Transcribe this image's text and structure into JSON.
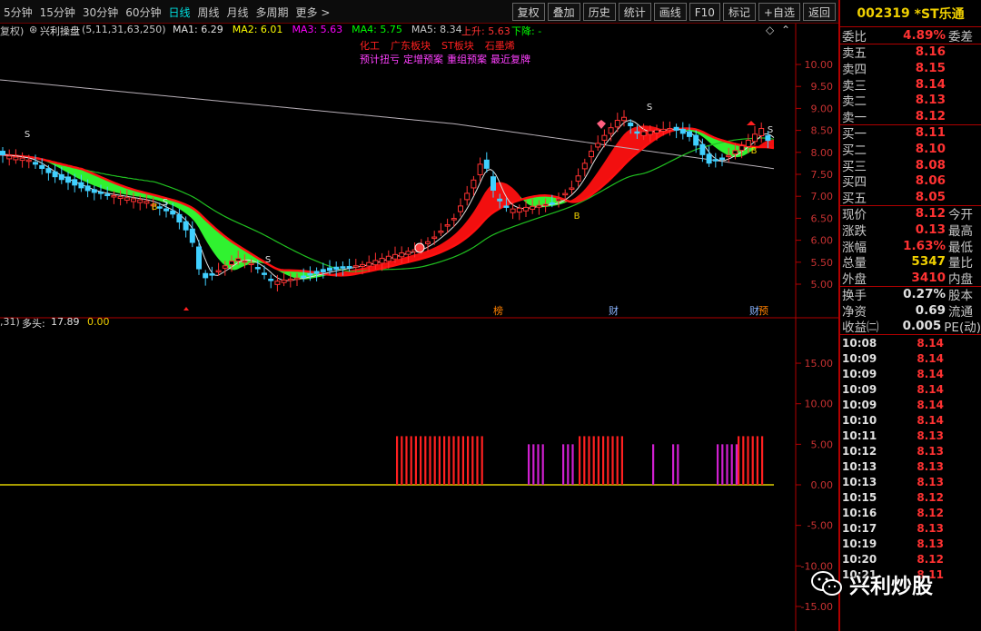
{
  "toolbar": {
    "periods": [
      "5分钟",
      "15分钟",
      "30分钟",
      "60分钟",
      "日线",
      "周线",
      "月线",
      "多周期",
      "更多 >"
    ],
    "active_period": "日线",
    "buttons": [
      "复权",
      "叠加",
      "历史",
      "统计",
      "画线",
      "F10",
      "标记",
      "+自选",
      "返回"
    ]
  },
  "main_chart": {
    "fuquan_label": "复权)",
    "indicator_name": "兴利操盘",
    "indicator_params": "(5,11,31,63,250)",
    "ma": [
      {
        "label": "MA1:",
        "value": "6.29",
        "color": "#e0e0e0"
      },
      {
        "label": "MA2:",
        "value": "6.01",
        "color": "#ffff00"
      },
      {
        "label": "MA3:",
        "value": "5.63",
        "color": "#ff00ff"
      },
      {
        "label": "MA4:",
        "value": "5.75",
        "color": "#00ff00"
      },
      {
        "label": "MA5:",
        "value": "8.34",
        "color": "#c8c8c8"
      }
    ],
    "up_label": "上升: 5.63",
    "down_label": "下降: -",
    "tags_line1": [
      "化工",
      "广东板块",
      "ST板块",
      "石墨烯"
    ],
    "tags_line2": [
      "预计扭亏",
      "定增预案",
      "重组预案",
      "最近复牌"
    ],
    "y_ticks": [
      "10.00",
      "9.50",
      "9.00",
      "8.50",
      "8.00",
      "7.50",
      "7.00",
      "6.50",
      "6.00",
      "5.50",
      "5.00"
    ],
    "events": [
      "榜",
      "财",
      "预"
    ]
  },
  "sub_chart": {
    "param": ",31)",
    "name": "多头:",
    "v1": "17.89",
    "v2": "0.00",
    "y_ticks": [
      "15.00",
      "10.00",
      "5.00",
      "0.00",
      "-5.00",
      "-10.00",
      "-15.00"
    ]
  },
  "chart_data": {
    "type": "bar",
    "title": "多头",
    "ylim": [
      -17,
      19
    ],
    "series": [
      {
        "name": "多头",
        "values_note": "bars at 6.0 during bullish periods"
      }
    ],
    "bars": [
      {
        "color": "#ff2020",
        "value": 6.0,
        "count": 19
      },
      {
        "color": "#d020d0",
        "value": 5.0,
        "count": 4
      },
      {
        "color": "#d020d0",
        "value": 5.0,
        "count": 3
      },
      {
        "color": "#ff2020",
        "value": 6.0,
        "count": 10
      },
      {
        "color": "#d020d0",
        "value": 5.0,
        "count": 1
      },
      {
        "color": "#d020d0",
        "value": 5.0,
        "count": 2
      },
      {
        "color": "#d020d0",
        "value": 5.0,
        "count": 5
      },
      {
        "color": "#ff2020",
        "value": 6.0,
        "count": 6
      }
    ]
  },
  "panel": {
    "code": "002319",
    "name": "*ST乐通",
    "weibi_label": "委比",
    "weibi_value": "4.89%",
    "weicha_label": "委差",
    "asks": [
      {
        "label": "卖五",
        "price": "8.16"
      },
      {
        "label": "卖四",
        "price": "8.15"
      },
      {
        "label": "卖三",
        "price": "8.14"
      },
      {
        "label": "卖二",
        "price": "8.13"
      },
      {
        "label": "卖一",
        "price": "8.12"
      }
    ],
    "bids": [
      {
        "label": "买一",
        "price": "8.11"
      },
      {
        "label": "买二",
        "price": "8.10"
      },
      {
        "label": "买三",
        "price": "8.08"
      },
      {
        "label": "买四",
        "price": "8.06"
      },
      {
        "label": "买五",
        "price": "8.05"
      }
    ],
    "stats": [
      {
        "label": "现价",
        "value": "8.12",
        "label2": "今开",
        "color": "#ff3232"
      },
      {
        "label": "涨跌",
        "value": "0.13",
        "label2": "最高",
        "color": "#ff3232"
      },
      {
        "label": "涨幅",
        "value": "1.63%",
        "label2": "最低",
        "color": "#ff3232"
      },
      {
        "label": "总量",
        "value": "5347",
        "label2": "量比",
        "color": "#f0d000"
      },
      {
        "label": "外盘",
        "value": "3410",
        "label2": "内盘",
        "color": "#ff3232"
      }
    ],
    "stats2": [
      {
        "label": "换手",
        "value": "0.27%",
        "label2": "股本",
        "color": "#e0e0e0"
      },
      {
        "label": "净资",
        "value": "0.69",
        "label2": "流通",
        "color": "#e0e0e0"
      },
      {
        "label": "收益㈡",
        "value": "0.005",
        "label2": "PE(动)",
        "color": "#e0e0e0"
      }
    ],
    "ticks": [
      {
        "time": "10:08",
        "price": "8.14"
      },
      {
        "time": "10:09",
        "price": "8.14"
      },
      {
        "time": "10:09",
        "price": "8.14"
      },
      {
        "time": "10:09",
        "price": "8.14"
      },
      {
        "time": "10:09",
        "price": "8.14"
      },
      {
        "time": "10:10",
        "price": "8.14"
      },
      {
        "time": "10:11",
        "price": "8.13"
      },
      {
        "time": "10:12",
        "price": "8.13"
      },
      {
        "time": "10:13",
        "price": "8.13"
      },
      {
        "time": "10:13",
        "price": "8.13"
      },
      {
        "time": "10:15",
        "price": "8.12"
      },
      {
        "time": "10:16",
        "price": "8.12"
      },
      {
        "time": "10:17",
        "price": "8.13"
      },
      {
        "time": "10:19",
        "price": "8.13"
      },
      {
        "time": "10:20",
        "price": "8.12"
      },
      {
        "time": "10:21",
        "price": "8.11"
      }
    ]
  },
  "watermark": {
    "text": "兴利炒股"
  }
}
